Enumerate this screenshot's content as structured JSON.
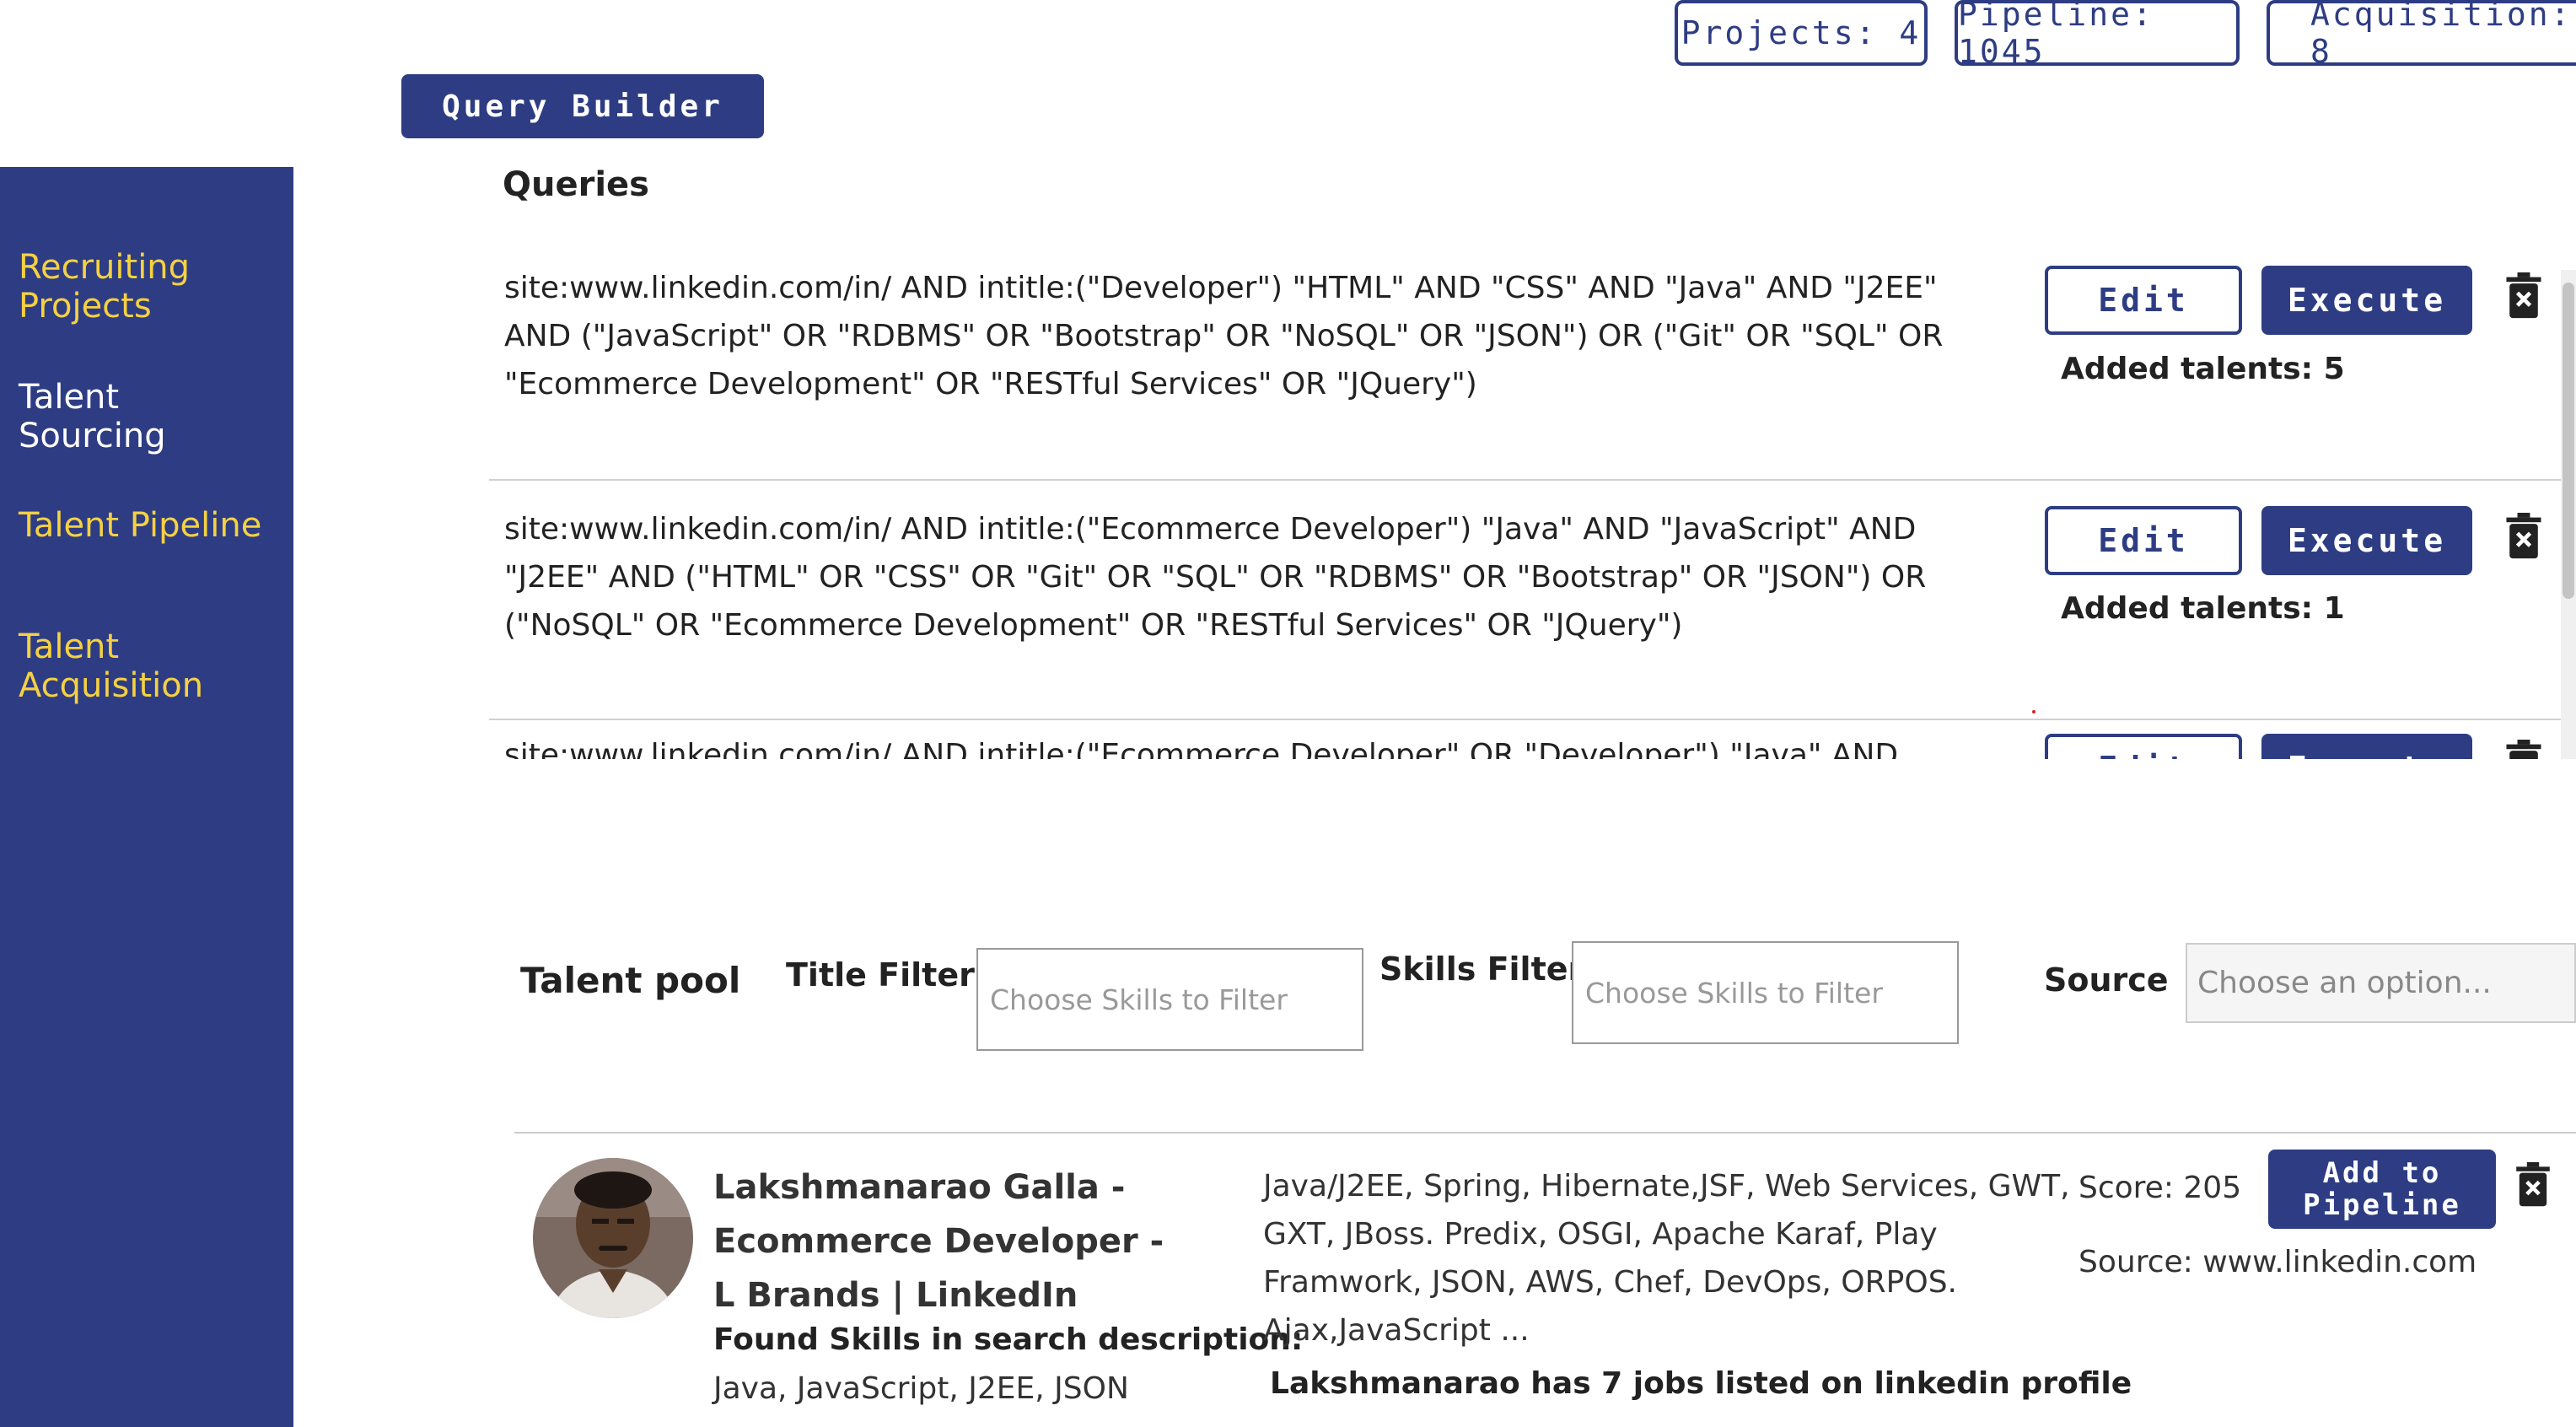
{
  "stats": {
    "projects": "Projects: 4",
    "pipeline": "Pipeline: 1045",
    "acquisition": "Acquisition: 8"
  },
  "query_builder_label": "Query Builder",
  "sidebar": {
    "items": [
      {
        "label": "Recruiting\nProjects",
        "color": "#f5d142"
      },
      {
        "label": "Talent\nSourcing",
        "color": "#ffffff"
      },
      {
        "label": "Talent Pipeline",
        "color": "#f5d142"
      },
      {
        "label": "Talent\nAcquisition",
        "color": "#f5d142"
      }
    ]
  },
  "queries": {
    "heading": "Queries",
    "edit_label": "Edit",
    "execute_label": "Execute",
    "items": [
      {
        "text": "site:www.linkedin.com/in/  AND intitle:(\"Developer\") \"HTML\" AND \"CSS\" AND \"Java\" AND \"J2EE\" AND (\"JavaScript\" OR \"RDBMS\" OR \"Bootstrap\" OR \"NoSQL\" OR \"JSON\") OR (\"Git\" OR \"SQL\" OR \"Ecommerce Development\" OR \"RESTful Services\" OR \"JQuery\")",
        "added": "Added talents: 5"
      },
      {
        "text": "site:www.linkedin.com/in/  AND intitle:(\"Ecommerce Developer\") \"Java\" AND \"JavaScript\" AND \"J2EE\" AND (\"HTML\" OR \"CSS\" OR \"Git\" OR \"SQL\" OR \"RDBMS\" OR \"Bootstrap\" OR \"JSON\") OR (\"NoSQL\" OR \"Ecommerce Development\" OR \"RESTful Services\" OR \"JQuery\")",
        "added": "Added talents: 1"
      },
      {
        "text": "site:www.linkedin.com/in/  AND intitle:(\"Ecommerce Developer\" OR \"Developer\") \"Java\" AND \"JavaScript\"",
        "added": ""
      }
    ]
  },
  "talent_pool": {
    "title": "Talent pool",
    "title_filter_label": "Title Filter",
    "title_filter_placeholder": "Choose Skills to Filter",
    "skills_filter_label": "Skills Filter",
    "skills_filter_placeholder": "Choose Skills to Filter",
    "source_label": "Source",
    "source_placeholder": "Choose an option..."
  },
  "candidate": {
    "name": "Lakshmanarao Galla - Ecommerce Developer - L Brands | LinkedIn",
    "found_label": "Found Skills in search description:",
    "found_skills": "Java, JavaScript, J2EE, JSON",
    "description": "Java/J2EE, Spring, Hibernate,JSF, Web Services, GWT, GXT, JBoss. Predix, OSGI, Apache Karaf, Play Framwork, JSON, AWS, Chef, DevOps, ORPOS. Ajax,JavaScript ...",
    "jobs": "Lakshmanarao has 7 jobs listed on linkedin profile",
    "score": "Score: 205",
    "source": "Source: www.linkedin.com",
    "add_label": "Add to\nPipeline"
  },
  "colors": {
    "brand": "#2e3d83",
    "nav_highlight": "#f5d142"
  }
}
